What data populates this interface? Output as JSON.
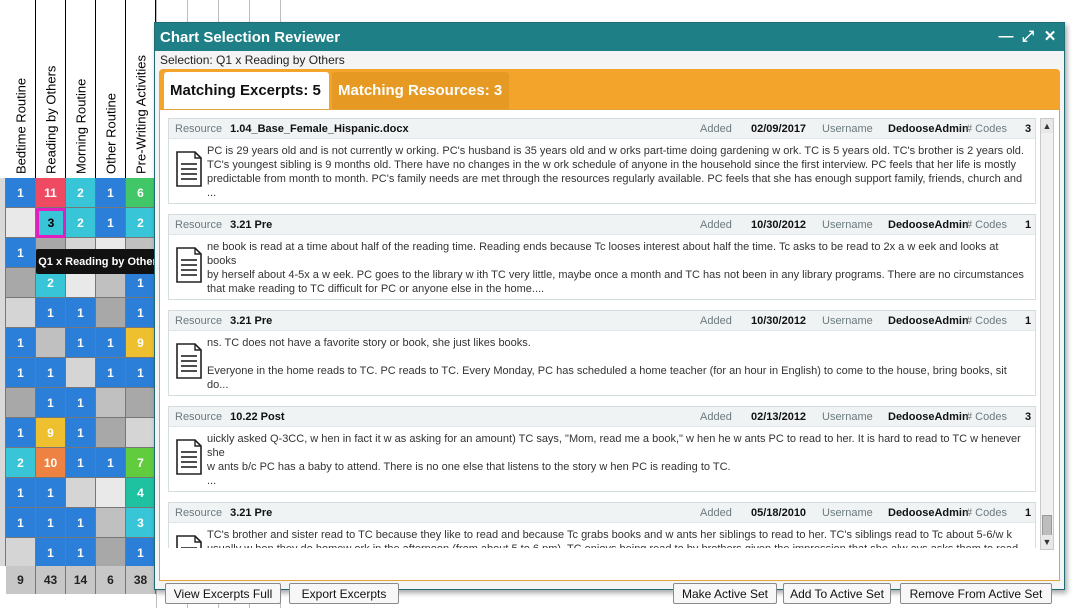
{
  "grid": {
    "columns": [
      "Bedtime Routine",
      "Reading by Others",
      "Morning Routine",
      "Other Routine",
      "Pre-Writing Activities"
    ],
    "rows": [
      [
        "1",
        "11",
        "2",
        "1",
        "6"
      ],
      [
        "",
        "3",
        "2",
        "1",
        "2"
      ],
      [
        "1",
        "",
        "",
        "",
        ""
      ],
      [
        "",
        "2",
        "",
        "",
        "1"
      ],
      [
        "",
        "1",
        "1",
        "",
        "1"
      ],
      [
        "1",
        "",
        "1",
        "1",
        "9"
      ],
      [
        "1",
        "1",
        "",
        "1",
        "1"
      ],
      [
        "",
        "1",
        "1",
        "",
        ""
      ],
      [
        "1",
        "9",
        "1",
        "",
        ""
      ],
      [
        "2",
        "10",
        "1",
        "1",
        "7"
      ],
      [
        "1",
        "1",
        "",
        "",
        "4"
      ],
      [
        "1",
        "1",
        "1",
        "",
        "3"
      ],
      [
        "",
        "1",
        "1",
        "",
        "1"
      ]
    ],
    "totals": [
      "9",
      "43",
      "14",
      "6",
      "38"
    ]
  },
  "tooltip": "Q1 x Reading by Others: 3",
  "dialog": {
    "title": "Chart Selection Reviewer",
    "selection": "Selection: Q1 x Reading by Others",
    "tabs": [
      {
        "label": "Matching Excerpts: 5",
        "active": true
      },
      {
        "label": "Matching Resources: 3",
        "active": false
      }
    ],
    "labels": {
      "resource": "Resource",
      "added": "Added",
      "username": "Username",
      "codes": "# Codes"
    },
    "excerpts": [
      {
        "resource": "1.04_Base_Female_Hispanic.docx",
        "added": "02/09/2017",
        "username": "DedooseAdmin",
        "codes": "3",
        "text": "PC is 29 years old and is not currently w orking.  PC's husband is 35 years old and w orks part-time doing gardening w ork.  TC is 5 years old.  TC's brother is 2 years old.\nTC's youngest sibling is 9 months old.  There have no changes in the w ork schedule of anyone in the household since the first interview.  PC feels that her life is mostly\npredictable from month to month. PC's family needs are met through the resources regularly available.  PC feels that she has enough support family, friends, church and ..."
      },
      {
        "resource": "3.21 Pre",
        "added": "10/30/2012",
        "username": "DedooseAdmin",
        "codes": "1",
        "text": "ne book is read at a time about half of the reading time.  Reading ends because Tc looses interest about half the time.  Tc asks to be read to 2x a w eek and looks at books\nby herself about 4-5x a w eek.  PC goes to the library w ith TC very little, maybe once a month and TC has not been in any library programs.  There are no circumstances\nthat make reading to TC difficult for PC or anyone else in the home...."
      },
      {
        "resource": "3.21 Pre",
        "added": "10/30/2012",
        "username": "DedooseAdmin",
        "codes": "1",
        "text": "ns.  TC does not have a favorite story or book, she just likes books.\n\nEveryone in the home reads to TC.  PC reads to TC.  Every Monday, PC has scheduled a home teacher (for an hour in English) to come to the house, bring books, sit do..."
      },
      {
        "resource": "10.22 Post",
        "added": "02/13/2012",
        "username": "DedooseAdmin",
        "codes": "3",
        "text": "uickly asked Q-3CC, w hen in fact it w as asking for an amount) TC says, \"Mom, read me a book,\" w hen he w ants PC to read to her. It is hard to read to TC w henever she\nw ants b/c PC has a baby to attend. There is no one else that listens to the story w hen PC is reading to TC.\n..."
      },
      {
        "resource": "3.21 Pre",
        "added": "05/18/2010",
        "username": "DedooseAdmin",
        "codes": "1",
        "text": "TC's brother and sister read to TC because they like to read and because Tc grabs books and w ants her siblings to read to her.  TC's siblings read to Tc about 5-6/w k\nusually w hen they do homew ork in the afternoon (from about 5 to 6 pm).  TC enjoys  being read to by brothers given the impression that she alw ays asks them to read to"
      }
    ],
    "buttons": {
      "view_full": "View Excerpts Full",
      "export": "Export Excerpts",
      "make_active": "Make Active Set",
      "add_active": "Add To Active Set",
      "remove_active": "Remove From Active Set"
    }
  },
  "colors": {
    "teal": "#1e7f86",
    "orange": "#f2a52a",
    "blue_cell": "#2b7fd8",
    "cyan_cell": "#39c5d8",
    "highlight": "#e11fbf"
  }
}
